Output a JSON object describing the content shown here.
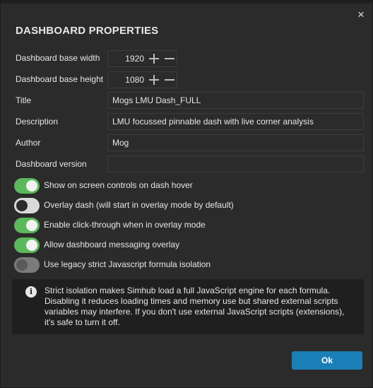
{
  "dialog": {
    "title": "DASHBOARD PROPERTIES",
    "close_icon": "×"
  },
  "fields": {
    "base_width": {
      "label": "Dashboard base width",
      "value": "1920"
    },
    "base_height": {
      "label": "Dashboard base height",
      "value": "1080"
    },
    "title": {
      "label": "Title",
      "value": "Mogs LMU Dash_FULL"
    },
    "description": {
      "label": "Description",
      "value": "LMU focussed pinnable dash with live corner analysis"
    },
    "author": {
      "label": "Author",
      "value": "Mog"
    },
    "version": {
      "label": "Dashboard version",
      "value": ""
    }
  },
  "toggles": [
    {
      "label": "Show on screen controls on dash hover",
      "state": "on"
    },
    {
      "label": "Overlay dash (will start in overlay mode by default)",
      "state": "off"
    },
    {
      "label": "Enable click-through when in overlay mode",
      "state": "on"
    },
    {
      "label": "Allow dashboard messaging overlay",
      "state": "on"
    },
    {
      "label": "Use legacy strict Javascript formula isolation",
      "state": "off-disabled"
    }
  ],
  "info": {
    "icon": "info-icon",
    "text": "Strict isolation makes Simhub load a full JavaScript engine for each formula. Disabling it reduces loading times and memory use but shared external scripts variables may interfere. If you don't use external JavaScript scripts (extensions), it's safe to turn it off."
  },
  "ok_label": "Ok",
  "colors": {
    "background": "#2b2b2b",
    "toggle_on": "#5cb85c",
    "ok_button": "#1b7fb7"
  }
}
